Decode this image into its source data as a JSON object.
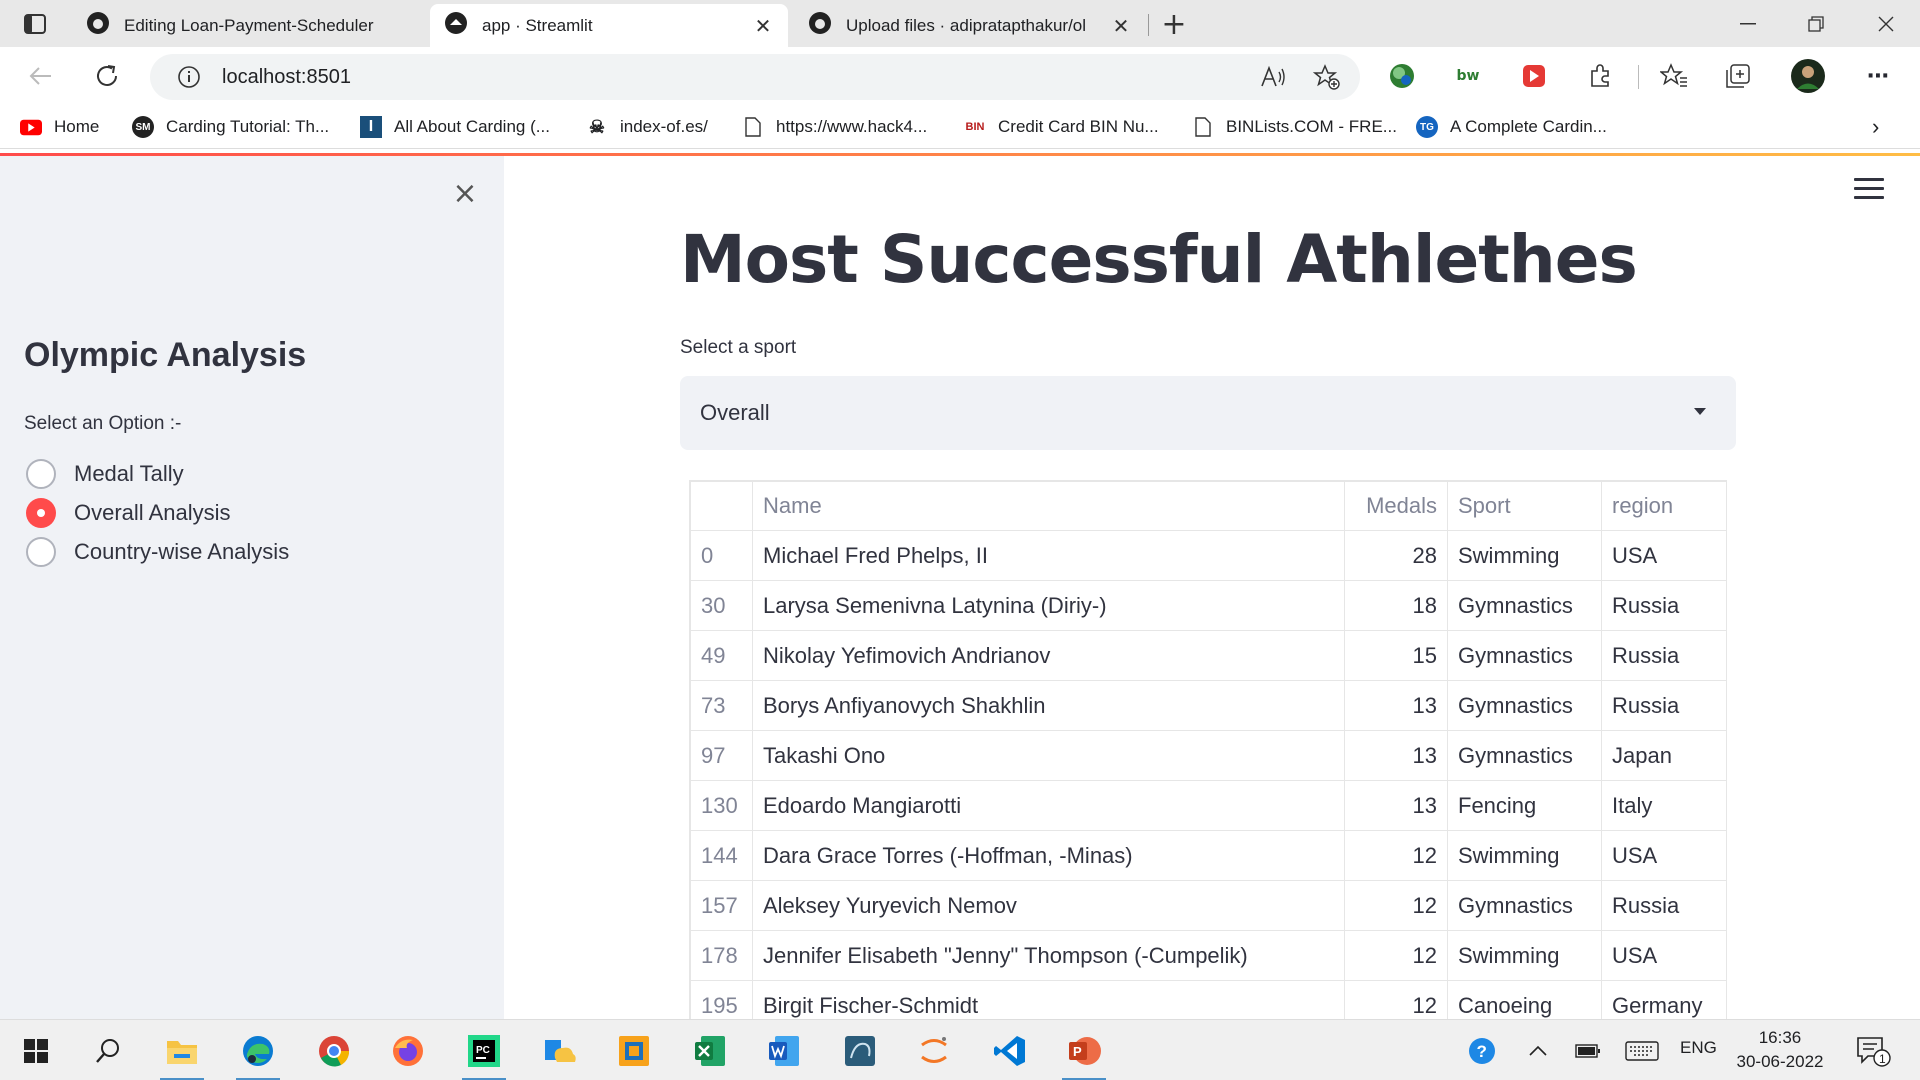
{
  "browser": {
    "tabs": [
      {
        "title": "Editing Loan-Payment-Scheduler",
        "icon": "github-icon"
      },
      {
        "title": "app · Streamlit",
        "icon": "streamlit-icon"
      },
      {
        "title": "Upload files · adipratapthakur/ol",
        "icon": "github-icon"
      }
    ],
    "url": "localhost:8501",
    "bookmarks": [
      {
        "label": "Home",
        "icon": "youtube-icon"
      },
      {
        "label": "Carding Tutorial: Th...",
        "icon": "sm-icon"
      },
      {
        "label": "All About Carding (...",
        "icon": "i-icon"
      },
      {
        "label": "index-of.es/",
        "icon": "skull-icon"
      },
      {
        "label": "https://www.hack4...",
        "icon": "page-icon"
      },
      {
        "label": "Credit Card BIN Nu...",
        "icon": "bin-icon"
      },
      {
        "label": "BINLists.COM - FRE...",
        "icon": "page-icon"
      },
      {
        "label": "A Complete Cardin...",
        "icon": "tg-icon"
      }
    ],
    "extensions": {
      "bw_label": "bw"
    }
  },
  "sidebar": {
    "title": "Olympic Analysis",
    "radio_label": "Select an Option :-",
    "options": [
      "Medal Tally",
      "Overall Analysis",
      "Country-wise Analysis"
    ],
    "selected_index": 1
  },
  "main": {
    "title": "Most Successful Athlethes",
    "select_label": "Select a sport",
    "select_value": "Overall",
    "table": {
      "columns": [
        "",
        "Name",
        "Medals",
        "Sport",
        "region"
      ],
      "rows": [
        [
          "0",
          "Michael Fred Phelps, II",
          "28",
          "Swimming",
          "USA"
        ],
        [
          "30",
          "Larysa Semenivna Latynina (Diriy-)",
          "18",
          "Gymnastics",
          "Russia"
        ],
        [
          "49",
          "Nikolay Yefimovich Andrianov",
          "15",
          "Gymnastics",
          "Russia"
        ],
        [
          "73",
          "Borys Anfiyanovych Shakhlin",
          "13",
          "Gymnastics",
          "Russia"
        ],
        [
          "97",
          "Takashi Ono",
          "13",
          "Gymnastics",
          "Japan"
        ],
        [
          "130",
          "Edoardo Mangiarotti",
          "13",
          "Fencing",
          "Italy"
        ],
        [
          "144",
          "Dara Grace Torres (-Hoffman, -Minas)",
          "12",
          "Swimming",
          "USA"
        ],
        [
          "157",
          "Aleksey Yuryevich Nemov",
          "12",
          "Gymnastics",
          "Russia"
        ],
        [
          "178",
          "Jennifer Elisabeth \"Jenny\" Thompson (-Cumpelik)",
          "12",
          "Swimming",
          "USA"
        ],
        [
          "195",
          "Birgit Fischer-Schmidt",
          "12",
          "Canoeing",
          "Germany"
        ]
      ]
    }
  },
  "taskbar": {
    "language": "ENG",
    "time": "16:36",
    "date": "30-06-2022",
    "notification_count": "1"
  },
  "colors": {
    "accent": "#ff4b4b",
    "sidebar_bg": "#f0f2f6",
    "text": "#31333f",
    "muted": "#808495"
  }
}
